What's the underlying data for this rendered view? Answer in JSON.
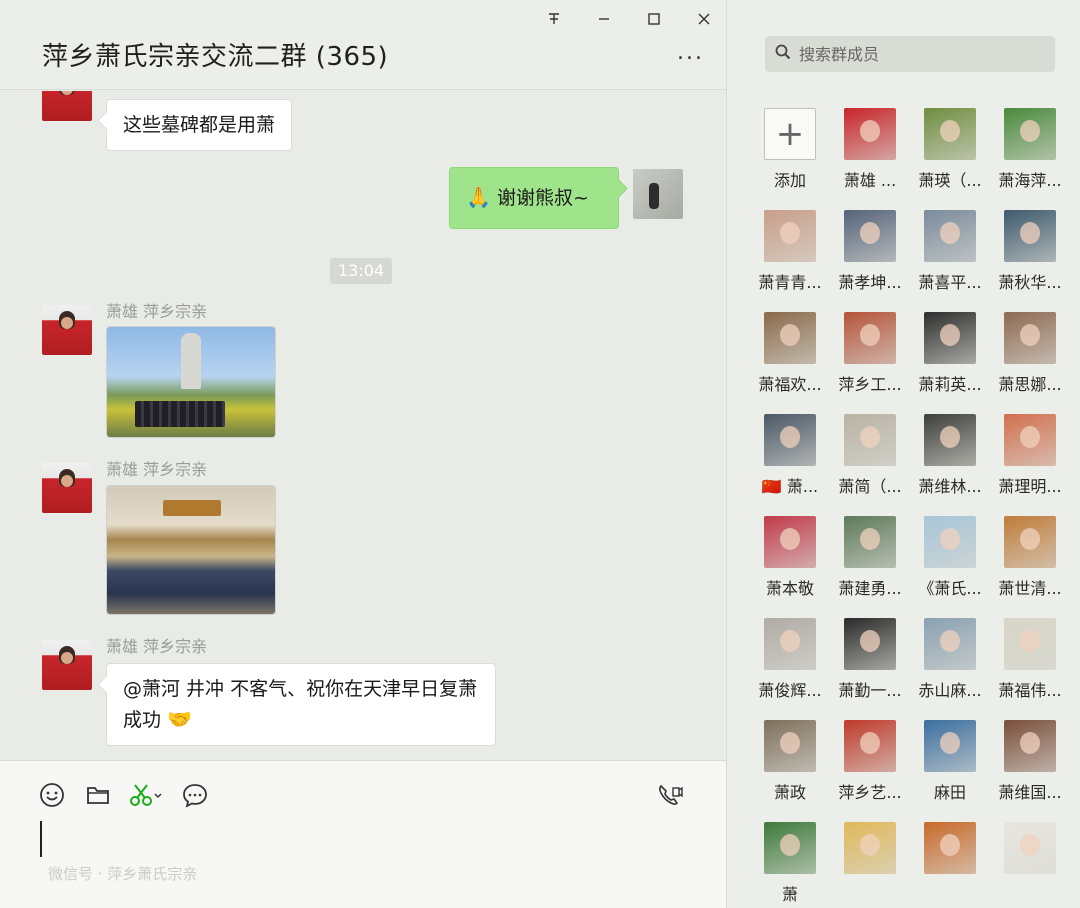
{
  "window": {
    "pin_icon": "pin-icon",
    "minimize_icon": "minimize-icon",
    "maximize_icon": "maximize-icon",
    "close_icon": "close-icon"
  },
  "chat": {
    "title": "萍乡萧氏宗亲交流二群 (365)",
    "more_label": "...",
    "messages": [
      {
        "type": "text",
        "side": "left",
        "text": "这些墓碑都是用萧"
      },
      {
        "type": "text",
        "side": "right",
        "text": "谢谢熊叔~",
        "emoji": "🙏"
      },
      {
        "type": "time",
        "text": "13:04"
      },
      {
        "type": "image",
        "side": "left",
        "sender": "萧雄 萍乡宗亲",
        "image": "statue-group-photo"
      },
      {
        "type": "image",
        "side": "left",
        "sender": "萧雄 萍乡宗亲",
        "image": "ancestral-hall-group-photo"
      },
      {
        "type": "text",
        "side": "left",
        "sender": "萧雄 萍乡宗亲",
        "text": "@萧河 井冲 不客气、祝你在天津早日复萧成功",
        "emoji": "🤝"
      }
    ]
  },
  "composer": {
    "tools": [
      "emoji-icon",
      "folder-icon",
      "scissors-icon",
      "chat-bubble-icon",
      "video-call-icon"
    ],
    "watermark": "微信号 · 萍乡萧氏宗亲"
  },
  "members_panel": {
    "search_placeholder": "搜索群成员",
    "members": [
      {
        "name": "添加",
        "kind": "add"
      },
      {
        "name": "萧雄 ...",
        "color": "#c8252a"
      },
      {
        "name": "萧瑛（...",
        "color": "#6f8e3f"
      },
      {
        "name": "萧海萍...",
        "color": "#4a8a3c"
      },
      {
        "name": "萧青青...",
        "color": "#c99f8a"
      },
      {
        "name": "萧孝坤...",
        "color": "#55647a"
      },
      {
        "name": "萧喜平...",
        "color": "#7a8b9c"
      },
      {
        "name": "萧秋华...",
        "color": "#3e5a6e"
      },
      {
        "name": "萧福欢...",
        "color": "#8a6a4a"
      },
      {
        "name": "萍乡工...",
        "color": "#b5543a"
      },
      {
        "name": "萧莉英...",
        "color": "#2e2e2e"
      },
      {
        "name": "萧思娜...",
        "color": "#8e6a52"
      },
      {
        "name": "🇨🇳 萧...",
        "color": "#4b5866"
      },
      {
        "name": "萧简（...",
        "color": "#b9b3a5"
      },
      {
        "name": "萧维林...",
        "color": "#3d3f3a"
      },
      {
        "name": "萧理明...",
        "color": "#d2704e"
      },
      {
        "name": "萧本敬",
        "color": "#c23a4a"
      },
      {
        "name": "萧建勇...",
        "color": "#5e7a5a"
      },
      {
        "name": "《萧氏...",
        "color": "#a8c6d8"
      },
      {
        "name": "萧世清...",
        "color": "#c07c3a"
      },
      {
        "name": "萧俊辉...",
        "color": "#b0aca5"
      },
      {
        "name": "萧勤一...",
        "color": "#2a2a2a"
      },
      {
        "name": "赤山麻...",
        "color": "#8aa1b2"
      },
      {
        "name": "萧福伟...",
        "color": "#d8d6c8"
      },
      {
        "name": "萧政",
        "color": "#7e6f5c"
      },
      {
        "name": "萍乡艺...",
        "color": "#c03a2a"
      },
      {
        "name": "麻田",
        "color": "#3b6ea0"
      },
      {
        "name": "萧维国...",
        "color": "#7a4e3a"
      },
      {
        "name": "萧",
        "color": "#3d7a3a"
      },
      {
        "name": "",
        "color": "#e0b85a"
      },
      {
        "name": "",
        "color": "#c86a2a"
      },
      {
        "name": "",
        "color": "#e8e6e0"
      }
    ]
  }
}
